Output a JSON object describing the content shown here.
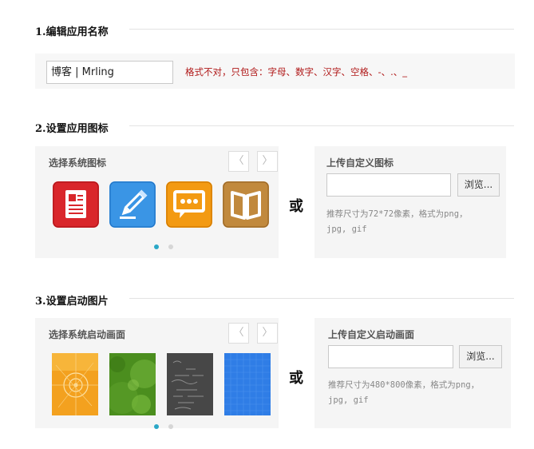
{
  "section1": {
    "title": "1.编辑应用名称",
    "name_value": "博客 | Mrling",
    "warning": "格式不对，只包含：字母、数字、汉字、空格、-、.、_"
  },
  "section2": {
    "title": "2.设置应用图标",
    "system_label": "选择系统图标",
    "prev": "〈",
    "next": "〉",
    "icons": [
      {
        "name": "document-icon",
        "color": "#d9262b"
      },
      {
        "name": "pencil-icon",
        "color": "#3a95e5"
      },
      {
        "name": "chat-icon",
        "color": "#f39a12"
      },
      {
        "name": "book-icon",
        "color": "#c1893d"
      }
    ],
    "or": "或",
    "upload_label": "上传自定义图标",
    "browse": "浏览...",
    "hint_line1": "推荐尺寸为72*72像素，格式为png，",
    "hint_line2": "jpg, gif"
  },
  "section3": {
    "title": "3.设置启动图片",
    "system_label": "选择系统启动画面",
    "prev": "〈",
    "next": "〉",
    "or": "或",
    "upload_label": "上传自定义启动画面",
    "browse": "浏览...",
    "hint_line1": "推荐尺寸为480*800像素，格式为png，",
    "hint_line2": "jpg, gif"
  },
  "colors": {
    "accent_dot": "#2aa7c6",
    "inactive_dot": "#d6d6d6",
    "warning": "#b01818"
  }
}
